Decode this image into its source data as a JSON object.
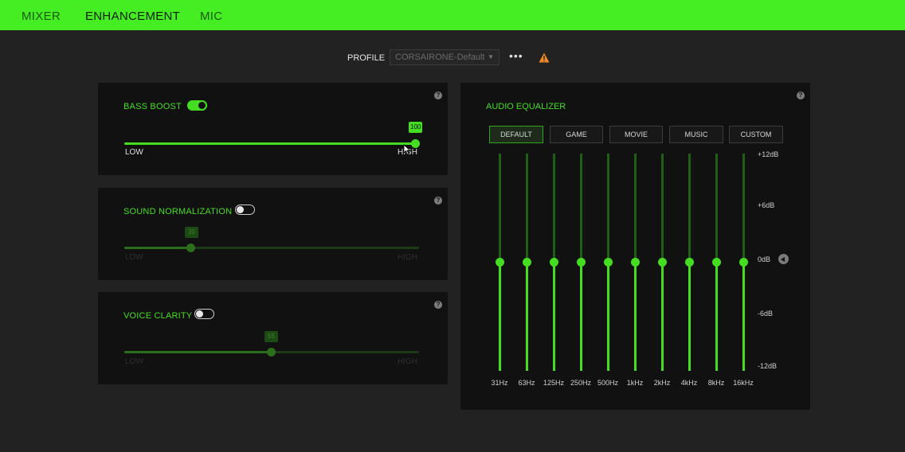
{
  "tabs": [
    {
      "label": "MIXER",
      "active": false
    },
    {
      "label": "ENHANCEMENT",
      "active": true
    },
    {
      "label": "MIC",
      "active": false
    }
  ],
  "profile": {
    "label": "PROFILE",
    "selected": "CORSAIRONE-Default",
    "more_label": "•••"
  },
  "panels": {
    "bass_boost": {
      "title": "BASS BOOST",
      "enabled": true,
      "value": 100,
      "low": "LOW",
      "high": "HIGH"
    },
    "sound_normalization": {
      "title": "SOUND NORMALIZATION",
      "enabled": false,
      "value": 30,
      "low": "LOW",
      "high": "HIGH"
    },
    "voice_clarity": {
      "title": "VOICE CLARITY",
      "enabled": false,
      "value": 55,
      "low": "LOW",
      "high": "HIGH"
    }
  },
  "equalizer": {
    "title": "AUDIO EQUALIZER",
    "presets": [
      "DEFAULT",
      "GAME",
      "MOVIE",
      "MUSIC",
      "CUSTOM"
    ],
    "active_preset": "DEFAULT",
    "bands": [
      {
        "freq": "31Hz",
        "gain": 0
      },
      {
        "freq": "63Hz",
        "gain": 0
      },
      {
        "freq": "125Hz",
        "gain": 0
      },
      {
        "freq": "250Hz",
        "gain": 0
      },
      {
        "freq": "500Hz",
        "gain": 0
      },
      {
        "freq": "1kHz",
        "gain": 0
      },
      {
        "freq": "2kHz",
        "gain": 0
      },
      {
        "freq": "4kHz",
        "gain": 0
      },
      {
        "freq": "8kHz",
        "gain": 0
      },
      {
        "freq": "16kHz",
        "gain": 0
      }
    ],
    "db_labels": [
      "+12dB",
      "+6dB",
      "0dB",
      "-6dB",
      "-12dB"
    ],
    "range": [
      -12,
      12
    ]
  },
  "help_label": "?",
  "colors": {
    "accent": "#44dd22",
    "topbar": "#44ee22",
    "panel": "#111111",
    "background": "#222222",
    "warning": "#f08a24"
  }
}
